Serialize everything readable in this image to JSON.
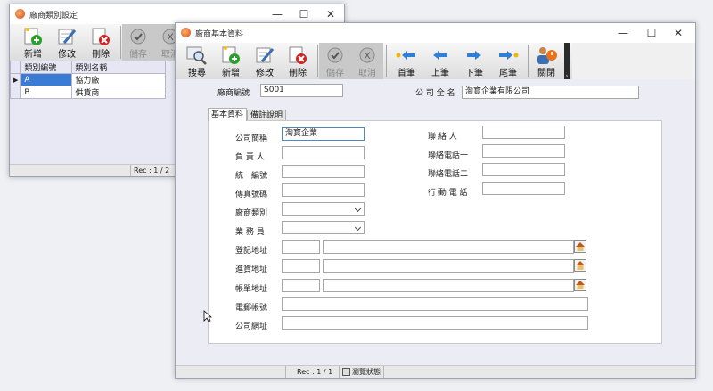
{
  "vendor_category_window": {
    "title": "廠商類別設定",
    "toolbar": {
      "new_label": "新增",
      "edit_label": "修改",
      "delete_label": "刪除",
      "save_label": "儲存",
      "cancel_label": "取消"
    },
    "grid": {
      "columns": [
        "類別編號",
        "類別名稱"
      ],
      "rows": [
        {
          "code": "A",
          "name": "協力廠"
        },
        {
          "code": "B",
          "name": "供貨商"
        }
      ]
    },
    "status": {
      "rec": "Rec : 1 / 2"
    }
  },
  "vendor_window": {
    "title": "廠商基本資料",
    "toolbar": {
      "search_label": "搜尋",
      "new_label": "新增",
      "edit_label": "修改",
      "delete_label": "刪除",
      "save_label": "儲存",
      "cancel_label": "取消",
      "first_label": "首筆",
      "prev_label": "上筆",
      "next_label": "下筆",
      "last_label": "尾筆",
      "close_label": "關閉"
    },
    "header": {
      "vendor_code_label": "廠商編號",
      "vendor_code_value": "S001",
      "company_name_label": "公 司 全 名",
      "company_name_value": "淘寶企業有限公司"
    },
    "tabs": {
      "basic": "基本資料",
      "notes": "備註說明"
    },
    "form": {
      "short_name_label": "公司簡稱",
      "short_name_value": "淘寶企業",
      "owner_label": "負 責 人",
      "tax_id_label": "統一編號",
      "fax_label": "傳真號碼",
      "category_label": "廠商類別",
      "salesperson_label": "業 務 員",
      "reg_address_label": "登記地址",
      "shipping_address_label": "進貨地址",
      "billing_address_label": "帳單地址",
      "email_label": "電郵帳號",
      "website_label": "公司網址",
      "contact_label": "聯 絡 人",
      "phone1_label": "聯絡電話一",
      "phone2_label": "聯絡電話二",
      "mobile_label": "行 動 電 話"
    },
    "status": {
      "rec": "Rec : 1 / 1",
      "mode": "瀏覽狀態"
    }
  },
  "colors": {
    "toolbar_icon_blue": "#2f7fd6",
    "delete_red": "#d42020",
    "new_green": "#2aa02a",
    "form_background": "#e4e4ee",
    "selection_blue": "#3a7bd5"
  }
}
